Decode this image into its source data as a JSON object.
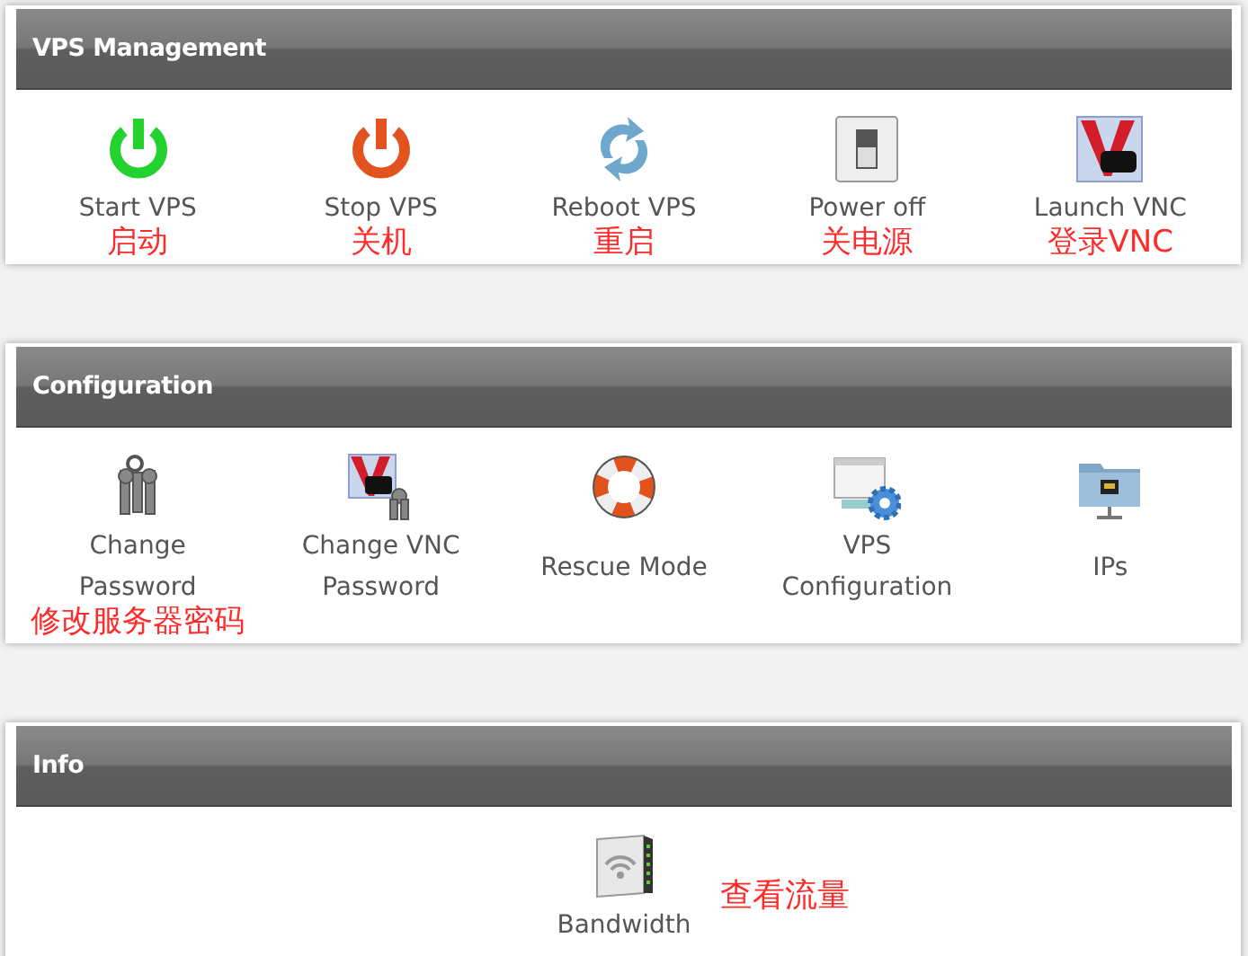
{
  "panels": [
    {
      "title": "VPS Management",
      "items": [
        {
          "label": "Start VPS",
          "note": "启动"
        },
        {
          "label": "Stop VPS",
          "note": "关机"
        },
        {
          "label": "Reboot VPS",
          "note": "重启"
        },
        {
          "label": "Power off",
          "note": "关电源"
        },
        {
          "label": "Launch VNC",
          "note": "登录VNC"
        }
      ]
    },
    {
      "title": "Configuration",
      "items": [
        {
          "label": "Change\nPassword",
          "note": "修改服务器密码"
        },
        {
          "label": "Change VNC\nPassword"
        },
        {
          "label": "Rescue Mode"
        },
        {
          "label": "VPS\nConfiguration"
        },
        {
          "label": "IPs"
        }
      ]
    },
    {
      "title": "Info",
      "items": [
        {
          "label": "Bandwidth"
        }
      ],
      "annotation": "查看流量"
    }
  ]
}
